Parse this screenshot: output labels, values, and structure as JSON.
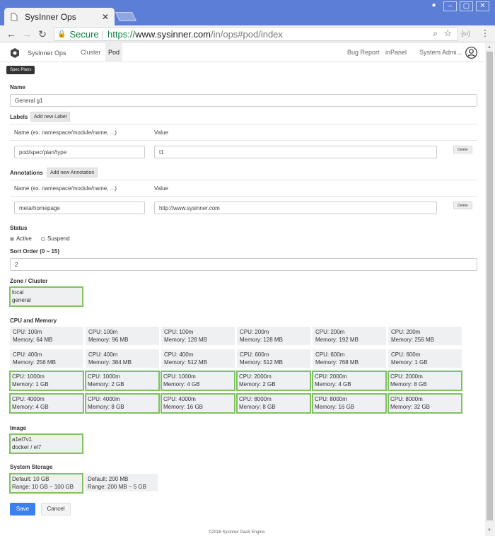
{
  "browser": {
    "tab_title": "SysInner Ops",
    "tab_close": "✕",
    "url": {
      "secure_label": "Secure",
      "scheme": "https://",
      "host": "www.sysinner.com",
      "path": "/in/ops#pod/index"
    },
    "extension_label": "{ω}"
  },
  "nav": {
    "brand": "SysInner Ops",
    "links": [
      "Cluster",
      "Pod"
    ],
    "active": "Pod",
    "right_links": [
      "Bug Report",
      "inPanel",
      "System Admi..."
    ]
  },
  "tooltip": "Spec Plans",
  "form": {
    "name_label": "Name",
    "name_value": "General g1",
    "labels": {
      "title": "Labels",
      "add_button": "Add new Label",
      "col_name": "Name (ex. namespace/module/name, ...)",
      "col_value": "Value",
      "row": {
        "name": "pod/spec/plan/type",
        "value": "t1",
        "delete": "Delete"
      }
    },
    "annotations": {
      "title": "Annotations",
      "add_button": "Add new Annotation",
      "col_name": "Name (ex. namespace/module/name, ...)",
      "col_value": "Value",
      "row": {
        "name": "meta/homepage",
        "value": "http://www.sysinner.com",
        "delete": "Delete"
      }
    },
    "status": {
      "title": "Status",
      "options": [
        "Active",
        "Suspend"
      ],
      "selected": "Active"
    },
    "sort_order": {
      "title": "Sort Order (0 ~ 15)",
      "value": "2"
    },
    "zone": {
      "title": "Zone / Cluster",
      "lines": [
        "local",
        "general"
      ]
    },
    "cpu_memory": {
      "title": "CPU and Memory",
      "options": [
        {
          "cpu": "CPU: 100m",
          "mem": "Memory: 64 MB",
          "selected": false
        },
        {
          "cpu": "CPU: 100m",
          "mem": "Memory: 96 MB",
          "selected": false
        },
        {
          "cpu": "CPU: 100m",
          "mem": "Memory: 128 MB",
          "selected": false
        },
        {
          "cpu": "CPU: 200m",
          "mem": "Memory: 128 MB",
          "selected": false
        },
        {
          "cpu": "CPU: 200m",
          "mem": "Memory: 192 MB",
          "selected": false
        },
        {
          "cpu": "CPU: 200m",
          "mem": "Memory: 256 MB",
          "selected": false
        },
        {
          "cpu": "CPU: 400m",
          "mem": "Memory: 256 MB",
          "selected": false
        },
        {
          "cpu": "CPU: 400m",
          "mem": "Memory: 384 MB",
          "selected": false
        },
        {
          "cpu": "CPU: 400m",
          "mem": "Memory: 512 MB",
          "selected": false
        },
        {
          "cpu": "CPU: 600m",
          "mem": "Memory: 512 MB",
          "selected": false
        },
        {
          "cpu": "CPU: 600m",
          "mem": "Memory: 768 MB",
          "selected": false
        },
        {
          "cpu": "CPU: 600m",
          "mem": "Memory: 1 GB",
          "selected": false
        },
        {
          "cpu": "CPU: 1000m",
          "mem": "Memory: 1 GB",
          "selected": true
        },
        {
          "cpu": "CPU: 1000m",
          "mem": "Memory: 2 GB",
          "selected": true
        },
        {
          "cpu": "CPU: 1000m",
          "mem": "Memory: 4 GB",
          "selected": true
        },
        {
          "cpu": "CPU: 2000m",
          "mem": "Memory: 2 GB",
          "selected": true
        },
        {
          "cpu": "CPU: 2000m",
          "mem": "Memory: 4 GB",
          "selected": true
        },
        {
          "cpu": "CPU: 2000m",
          "mem": "Memory: 8 GB",
          "selected": true
        },
        {
          "cpu": "CPU: 4000m",
          "mem": "Memory: 4 GB",
          "selected": true
        },
        {
          "cpu": "CPU: 4000m",
          "mem": "Memory: 8 GB",
          "selected": true
        },
        {
          "cpu": "CPU: 4000m",
          "mem": "Memory: 16 GB",
          "selected": true
        },
        {
          "cpu": "CPU: 8000m",
          "mem": "Memory: 8 GB",
          "selected": true
        },
        {
          "cpu": "CPU: 8000m",
          "mem": "Memory: 16 GB",
          "selected": true
        },
        {
          "cpu": "CPU: 8000m",
          "mem": "Memory: 32 GB",
          "selected": true
        }
      ]
    },
    "image": {
      "title": "Image",
      "lines": [
        "a1el7v1",
        "docker / el7"
      ]
    },
    "storage": {
      "title": "System Storage",
      "options": [
        {
          "line1": "Default: 10 GB",
          "line2": "Range: 10 GB ~ 100 GB",
          "selected": true
        },
        {
          "line1": "Default: 200 MB",
          "line2": "Range: 200 MB ~ 5 GB",
          "selected": false
        }
      ]
    },
    "save_label": "Save",
    "cancel_label": "Cancel"
  },
  "footer": "©2018 Sysinner PaaS Engine",
  "colors": {
    "accent": "#3b7ff0",
    "selected_border": "#7fc25f",
    "chrome": "#5c7ed6"
  }
}
